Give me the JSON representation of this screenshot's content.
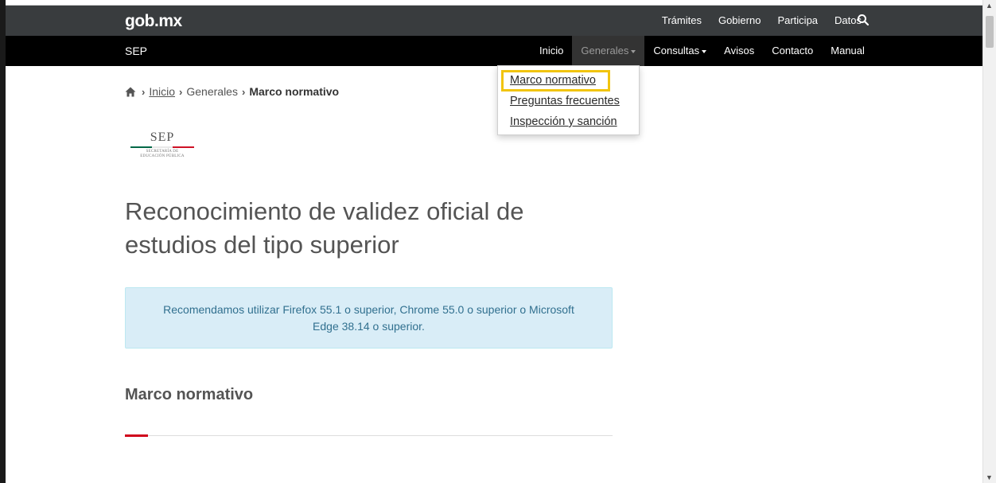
{
  "header": {
    "brand_name": "gob",
    "brand_suffix": "mx",
    "top_nav": [
      "Trámites",
      "Gobierno",
      "Participa",
      "Datos"
    ],
    "search_icon": "search-icon"
  },
  "subheader": {
    "site_label": "SEP",
    "nav": [
      "Inicio",
      "Generales",
      "Consultas",
      "Avisos",
      "Contacto",
      "Manual"
    ],
    "active_item": "Generales"
  },
  "dropdown": {
    "items": [
      "Marco normativo",
      "Preguntas frecuentes",
      "Inspección y sanción"
    ],
    "highlighted": "Marco normativo",
    "highlight_color": "#f1c40f"
  },
  "breadcrumb": {
    "home_icon": "home-icon",
    "link": "Inicio",
    "middle": "Generales",
    "current": "Marco normativo"
  },
  "logo": {
    "title": "SEP",
    "line1": "SECRETARÍA DE",
    "line2": "EDUCACIÓN PÚBLICA",
    "colors": [
      "#006847",
      "#ffffff",
      "#ce1126"
    ]
  },
  "main": {
    "title": "Reconocimiento de validez oficial de estudios del tipo superior",
    "alert_text": "Recomendamos utilizar Firefox 55.1 o superior, Chrome 55.0 o superior o Microsoft Edge 38.14 o superior.",
    "section_title": "Marco normativo",
    "accent_color": "#d0021b"
  }
}
